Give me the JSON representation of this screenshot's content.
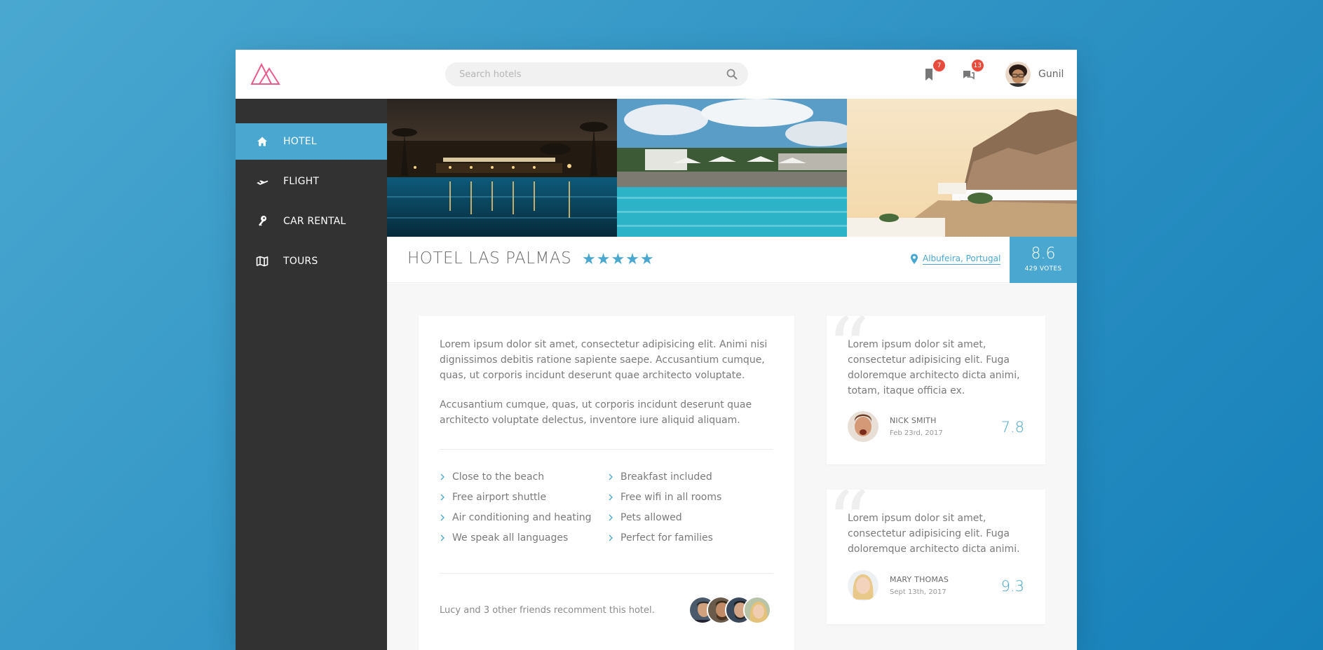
{
  "header": {
    "search_placeholder": "Search hotels",
    "bookmarks_count": "7",
    "messages_count": "13",
    "user_name": "Gunil"
  },
  "sidebar": {
    "items": [
      {
        "label": "HOTEL",
        "icon": "home-icon",
        "active": true
      },
      {
        "label": "FLIGHT",
        "icon": "plane-icon",
        "active": false
      },
      {
        "label": "CAR RENTAL",
        "icon": "key-icon",
        "active": false
      },
      {
        "label": "TOURS",
        "icon": "map-icon",
        "active": false
      }
    ]
  },
  "hotel": {
    "name": "HOTEL LAS PALMAS",
    "stars": "★★★★★",
    "location": "Albufeira, Portugal",
    "score": "8.6",
    "votes": "429 VOTES"
  },
  "description": {
    "paragraphs": [
      "Lorem ipsum dolor sit amet, consectetur adipisicing elit. Animi nisi dignissimos debitis ratione sapiente saepe. Accusantium cumque, quas, ut corporis incidunt deserunt quae architecto voluptate.",
      "Accusantium cumque, quas, ut corporis incidunt deserunt quae architecto voluptate delectus, inventore iure aliquid aliquam."
    ],
    "features": [
      "Close to the beach",
      "Breakfast included",
      "Free airport shuttle",
      "Free wifi in all rooms",
      "Air conditioning and heating",
      "Pets allowed",
      "We speak all languages",
      "Perfect for families"
    ],
    "friends_text": "Lucy and 3 other friends recomment this hotel."
  },
  "reviews": [
    {
      "text": "Lorem ipsum dolor sit amet, consectetur adipisicing elit. Fuga doloremque architecto dicta animi, totam, itaque officia ex.",
      "name": "NICK SMITH",
      "date": "Feb 23rd, 2017",
      "score": "7.8"
    },
    {
      "text": "Lorem ipsum dolor sit amet, consectetur adipisicing elit. Fuga doloremque architecto dicta animi.",
      "name": "MARY THOMAS",
      "date": "Sept 13th, 2017",
      "score": "9.3"
    }
  ],
  "colors": {
    "accent": "#4aa8d0",
    "sidebar_bg": "#323232",
    "badge": "#e74c3c",
    "logo": "#e85d8a"
  }
}
